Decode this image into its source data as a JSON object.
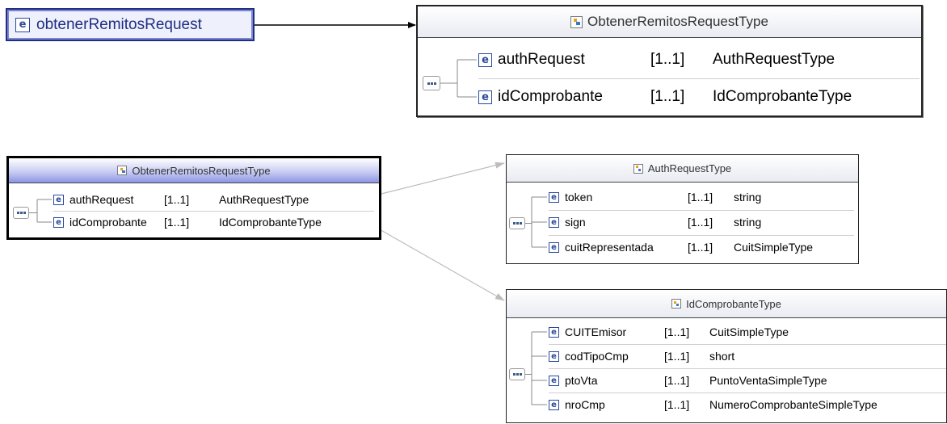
{
  "root_element": {
    "label": "obtenerRemitosRequest",
    "icon": "element-icon"
  },
  "types": [
    {
      "id": "main",
      "title": "ObtenerRemitosRequestType",
      "icon": "complex-type-icon",
      "rows": [
        {
          "name": "authRequest",
          "card": "[1..1]",
          "type": "AuthRequestType"
        },
        {
          "name": "idComprobante",
          "card": "[1..1]",
          "type": "IdComprobanteType"
        }
      ]
    },
    {
      "id": "main_small",
      "title": "ObtenerRemitosRequestType",
      "icon": "complex-type-icon",
      "rows": [
        {
          "name": "authRequest",
          "card": "[1..1]",
          "type": "AuthRequestType"
        },
        {
          "name": "idComprobante",
          "card": "[1..1]",
          "type": "IdComprobanteType"
        }
      ]
    },
    {
      "id": "auth",
      "title": "AuthRequestType",
      "icon": "complex-type-icon",
      "rows": [
        {
          "name": "token",
          "card": "[1..1]",
          "type": "string"
        },
        {
          "name": "sign",
          "card": "[1..1]",
          "type": "string"
        },
        {
          "name": "cuitRepresentada",
          "card": "[1..1]",
          "type": "CuitSimpleType"
        }
      ]
    },
    {
      "id": "idcomp",
      "title": "IdComprobanteType",
      "icon": "complex-type-icon",
      "rows": [
        {
          "name": "CUITEmisor",
          "card": "[1..1]",
          "type": "CuitSimpleType"
        },
        {
          "name": "codTipoCmp",
          "card": "[1..1]",
          "type": "short"
        },
        {
          "name": "ptoVta",
          "card": "[1..1]",
          "type": "PuntoVentaSimpleType"
        },
        {
          "name": "nroCmp",
          "card": "[1..1]",
          "type": "NumeroComprobanteSimpleType"
        }
      ]
    }
  ],
  "colors": {
    "selection_border": "#1f2e84",
    "element_icon": "#2b4a9b",
    "connector": "#bdbdbd"
  }
}
